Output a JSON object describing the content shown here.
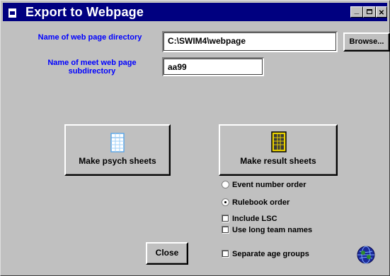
{
  "window": {
    "title": "Export to Webpage",
    "minimize_glyph": "_",
    "maximize_glyph": "□",
    "close_glyph": "✕"
  },
  "fields": {
    "web_dir_label": "Name of web page directory",
    "web_dir_value": "C:\\SWIM4\\webpage",
    "browse_label": "Browse...",
    "subdir_label": "Name of meet web page subdirectory",
    "subdir_value": "aa99"
  },
  "actions": {
    "psych_label": "Make psych sheets",
    "result_label": "Make result sheets",
    "close_label": "Close"
  },
  "options": {
    "event_number_order": "Event number order",
    "rulebook_order": "Rulebook order",
    "include_lsc": "Include LSC",
    "use_long_team_names": "Use long team names",
    "separate_age_groups": "Separate age groups",
    "selected_order": "rulebook_order"
  },
  "icons": {
    "title": "window-icon",
    "psych": "psych-sheet-icon",
    "result": "result-sheet-icon",
    "logo": "globe-logo-icon"
  },
  "colors": {
    "title_bar": "#000080",
    "label_blue": "#0000ff",
    "face": "#c0c0c0"
  }
}
